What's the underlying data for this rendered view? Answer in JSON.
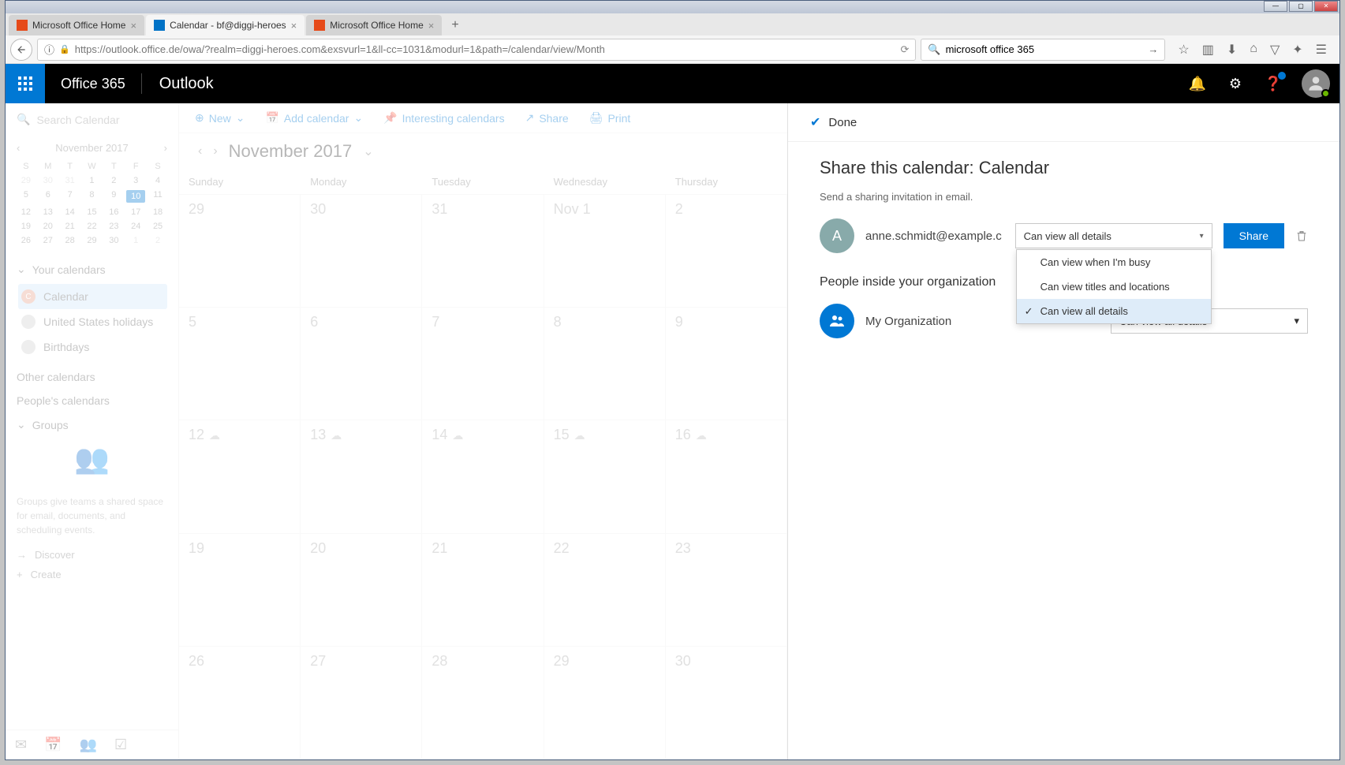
{
  "window": {
    "min": "—",
    "max": "▢",
    "close": "✕"
  },
  "tabs": [
    {
      "label": "Microsoft Office Home",
      "icon_color": "#e64a19",
      "active": false
    },
    {
      "label": "Calendar - bf@diggi-heroes",
      "icon_color": "#0072c6",
      "active": true
    },
    {
      "label": "Microsoft Office Home",
      "icon_color": "#e64a19",
      "active": false
    }
  ],
  "addressbar": {
    "url": "https://outlook.office.de/owa/?realm=diggi-heroes.com&exsvurl=1&ll-cc=1031&modurl=1&path=/calendar/view/Month",
    "search": "microsoft office 365"
  },
  "o365": {
    "suite": "Office 365",
    "app": "Outlook"
  },
  "sidebar": {
    "search_placeholder": "Search Calendar",
    "month_label": "November 2017",
    "dow": [
      "S",
      "M",
      "T",
      "W",
      "T",
      "F",
      "S"
    ],
    "mini_days": [
      [
        "29",
        "30",
        "31",
        "1",
        "2",
        "3",
        "4"
      ],
      [
        "5",
        "6",
        "7",
        "8",
        "9",
        "10",
        "11"
      ],
      [
        "12",
        "13",
        "14",
        "15",
        "16",
        "17",
        "18"
      ],
      [
        "19",
        "20",
        "21",
        "22",
        "23",
        "24",
        "25"
      ],
      [
        "26",
        "27",
        "28",
        "29",
        "30",
        "1",
        "2"
      ]
    ],
    "mini_today_row": 1,
    "mini_today_col": 5,
    "your_calendars": "Your calendars",
    "calendars": [
      {
        "label": "Calendar",
        "color": "#e8a088",
        "initial": "C",
        "selected": true
      },
      {
        "label": "United States holidays",
        "color": "#d0d0d0",
        "initial": ""
      },
      {
        "label": "Birthdays",
        "color": "#d0d0d0",
        "initial": ""
      }
    ],
    "other_calendars": "Other calendars",
    "peoples_calendars": "People's calendars",
    "groups": "Groups",
    "groups_empty": "Groups give teams a shared space for email, documents, and scheduling events.",
    "discover": "Discover",
    "create": "Create"
  },
  "toolbar": {
    "new": "New",
    "add_calendar": "Add calendar",
    "interesting": "Interesting calendars",
    "share": "Share",
    "print": "Print"
  },
  "calendar_view": {
    "title": "November 2017",
    "dow": [
      "Sunday",
      "Monday",
      "Tuesday",
      "Wednesday",
      "Thursday"
    ],
    "weeks": [
      [
        "29",
        "30",
        "31",
        "Nov 1",
        "2"
      ],
      [
        "5",
        "6",
        "7",
        "8",
        "9"
      ],
      [
        "12",
        "13",
        "14",
        "15",
        "16"
      ],
      [
        "19",
        "20",
        "21",
        "22",
        "23"
      ],
      [
        "26",
        "27",
        "28",
        "29",
        "30"
      ]
    ],
    "weather_row": 2
  },
  "share_panel": {
    "done": "Done",
    "title": "Share this calendar: Calendar",
    "subtitle": "Send a sharing invitation in email.",
    "invitee": {
      "initial": "A",
      "email": "anne.schmidt@example.c",
      "permission": "Can view all details"
    },
    "share_button": "Share",
    "dropdown_options": [
      "Can view when I'm busy",
      "Can view titles and locations",
      "Can view all details"
    ],
    "dropdown_selected_index": 2,
    "org_section": "People inside your organization",
    "org": {
      "name": "My Organization",
      "permission": "Can view all details"
    }
  }
}
